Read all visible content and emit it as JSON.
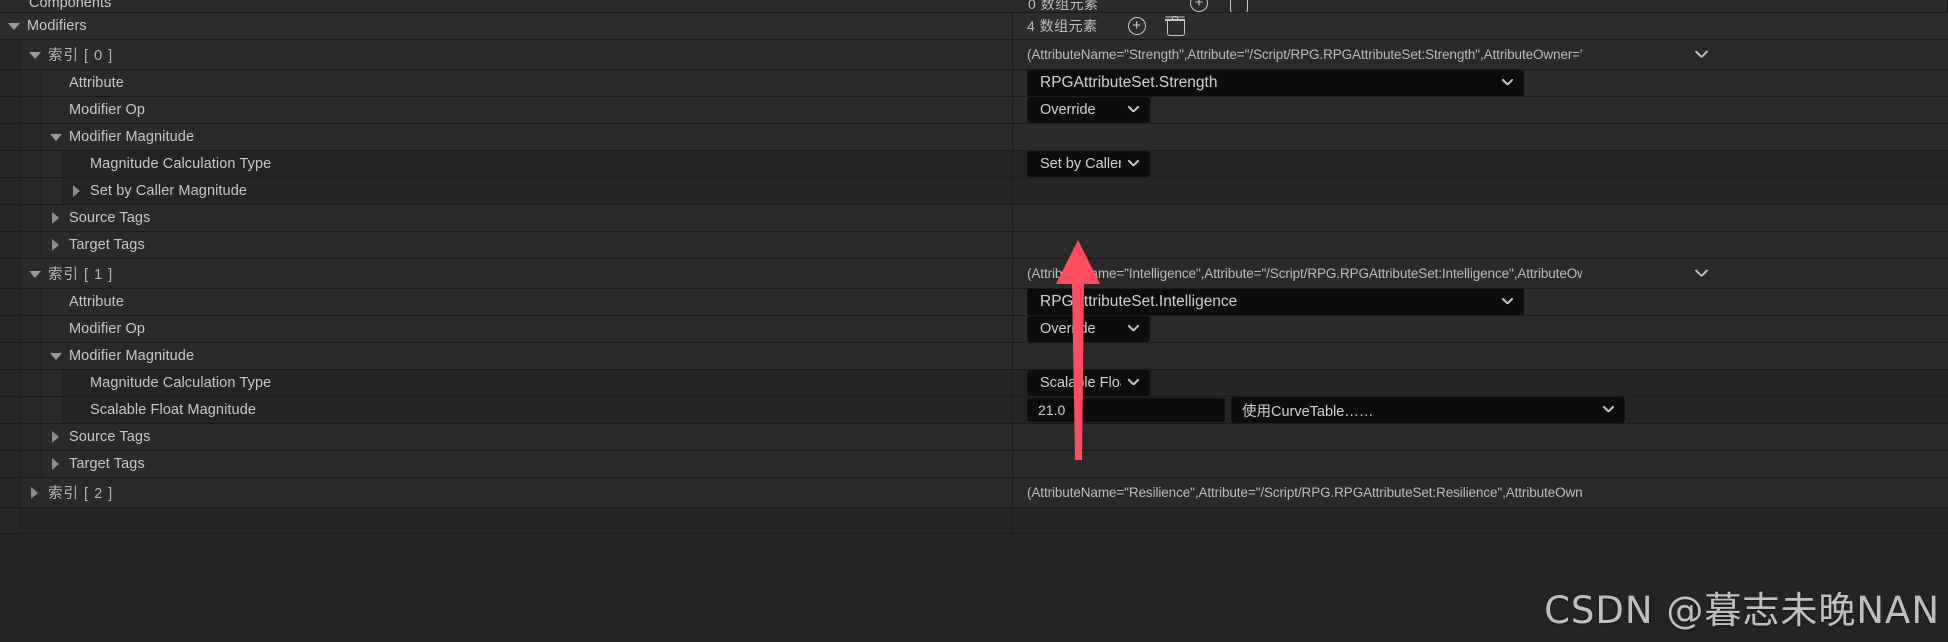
{
  "panel": {
    "clipped_top_row": {
      "label": "Components",
      "array_count": "0 数组元素",
      "add_icon": "plus-circle-icon",
      "delete_icon": "trash-icon"
    },
    "watermark": "CSDN @暮志未晚NAN",
    "colors": {
      "row_bg": "#2a2a2a",
      "row_bg_alt": "#242424",
      "row_border": "#1b1b1b",
      "text": "#c8c8c8",
      "combo_bg": "#0d0d0d",
      "arrow_red": "#ff4d5e"
    },
    "annotation": {
      "type": "arrow",
      "direction": "up",
      "color": "#ff4d5e",
      "points_at": "magnitude-calculation-type-combo"
    }
  },
  "rows": [
    {
      "id": "modifiers-header",
      "label": "Modifiers",
      "indent": 0,
      "twisty": "down",
      "array_count": "4 数组元素",
      "add_icon": "plus-circle-icon",
      "delete_icon": "trash-icon"
    },
    {
      "id": "index-0",
      "label": "索引 [ 0 ]",
      "indent": 1,
      "twisty": "down",
      "struct_text": "(AttributeName=\"Strength\",Attribute=\"/Script/RPG.RPGAttributeSet:Strength\",AttributeOwner=\"/Scrip",
      "chevron": true
    },
    {
      "id": "index-0-attribute",
      "label": "Attribute",
      "indent": 2,
      "twisty": "none",
      "combo": {
        "value": "RPGAttributeSet.Strength",
        "size": "wide"
      }
    },
    {
      "id": "index-0-modifier-op",
      "label": "Modifier Op",
      "indent": 2,
      "twisty": "none",
      "combo": {
        "value": "Override",
        "size": "small"
      }
    },
    {
      "id": "index-0-modifier-magnitude",
      "label": "Modifier Magnitude",
      "indent": 2,
      "twisty": "down"
    },
    {
      "id": "index-0-magnitude-calculation-type",
      "label": "Magnitude Calculation Type",
      "indent": 3,
      "twisty": "none",
      "combo": {
        "value": "Set by Caller",
        "size": "small"
      }
    },
    {
      "id": "index-0-set-by-caller-magnitude",
      "label": "Set by Caller Magnitude",
      "indent": 3,
      "twisty": "right"
    },
    {
      "id": "index-0-source-tags",
      "label": "Source Tags",
      "indent": 2,
      "twisty": "right"
    },
    {
      "id": "index-0-target-tags",
      "label": "Target Tags",
      "indent": 2,
      "twisty": "right"
    },
    {
      "id": "index-1",
      "label": "索引 [ 1 ]",
      "indent": 1,
      "twisty": "down",
      "struct_text": "(AttributeName=\"Intelligence\",Attribute=\"/Script/RPG.RPGAttributeSet:Intelligence\",AttributeOwner='",
      "chevron": true
    },
    {
      "id": "index-1-attribute",
      "label": "Attribute",
      "indent": 2,
      "twisty": "none",
      "combo": {
        "value": "RPGAttributeSet.Intelligence",
        "size": "wide"
      }
    },
    {
      "id": "index-1-modifier-op",
      "label": "Modifier Op",
      "indent": 2,
      "twisty": "none",
      "combo": {
        "value": "Override",
        "size": "small"
      }
    },
    {
      "id": "index-1-modifier-magnitude",
      "label": "Modifier Magnitude",
      "indent": 2,
      "twisty": "down"
    },
    {
      "id": "index-1-magnitude-calculation-type",
      "label": "Magnitude Calculation Type",
      "indent": 3,
      "twisty": "none",
      "combo": {
        "value": "Scalable Float",
        "size": "small"
      }
    },
    {
      "id": "index-1-scalable-float-magnitude",
      "label": "Scalable Float Magnitude",
      "indent": 3,
      "twisty": "none",
      "number_value": "21.0",
      "curve_combo": {
        "value": "使用CurveTable……"
      }
    },
    {
      "id": "index-1-source-tags",
      "label": "Source Tags",
      "indent": 2,
      "twisty": "right"
    },
    {
      "id": "index-1-target-tags",
      "label": "Target Tags",
      "indent": 2,
      "twisty": "right"
    },
    {
      "id": "index-2",
      "label": "索引 [ 2 ]",
      "indent": 1,
      "twisty": "right",
      "struct_text": "(AttributeName=\"Resilience\",Attribute=\"/Script/RPG.RPGAttributeSet:Resilience\",AttributeOwner=\"/S",
      "chevron": false
    }
  ]
}
